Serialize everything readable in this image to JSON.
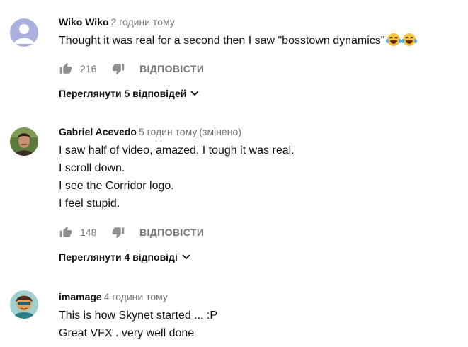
{
  "comments": [
    {
      "author": "Wiko Wiko",
      "time": "2 години тому",
      "edited": "",
      "lines": [
        "Thought it was real for a second then I saw \"bosstown dynamics\""
      ],
      "emoji": [
        "face-with-tears-of-joy",
        "face-with-tears-of-joy"
      ],
      "likes": "216",
      "reply_label": "ВІДПОВІСТИ",
      "view_replies": "Переглянути 5 відповідей",
      "avatar": "default-user-avatar"
    },
    {
      "author": "Gabriel Acevedo",
      "time": "5 годин тому",
      "edited": "(змінено)",
      "lines": [
        "I saw half of video, amazed. I tough it was real.",
        "I scroll down.",
        "I see the Corridor logo.",
        "I feel stupid."
      ],
      "likes": "148",
      "reply_label": "ВІДПОВІСТИ",
      "view_replies": "Переглянути 4 відповіді",
      "avatar": "photo-avatar"
    },
    {
      "author": "imamage",
      "time": "4 години тому",
      "edited": "",
      "lines": [
        "This is how Skynet started ... :P",
        "Great VFX . very well done"
      ],
      "avatar": "cartoon-avatar"
    }
  ],
  "colors": {
    "text": "#111111",
    "secondary": "#767676",
    "default_avatar_bg": "#a9b0de"
  }
}
